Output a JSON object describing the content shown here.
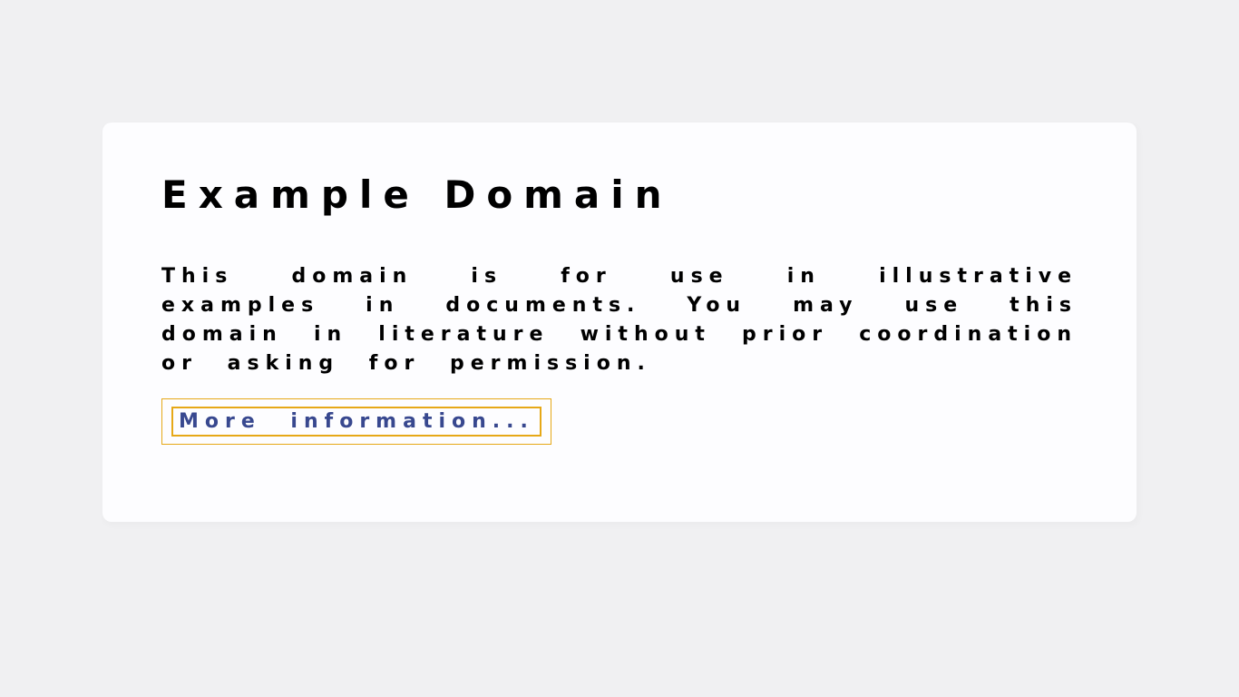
{
  "heading": "Example Domain",
  "description": "This domain is for use in illustrative examples in documents. You may use this domain in literature without prior coordination or asking for permission.",
  "link_text": "More information...",
  "colors": {
    "background": "#f0f0f2",
    "card_background": "#fdfdff",
    "link_color": "#38488f",
    "highlight_border": "#e6a817"
  }
}
